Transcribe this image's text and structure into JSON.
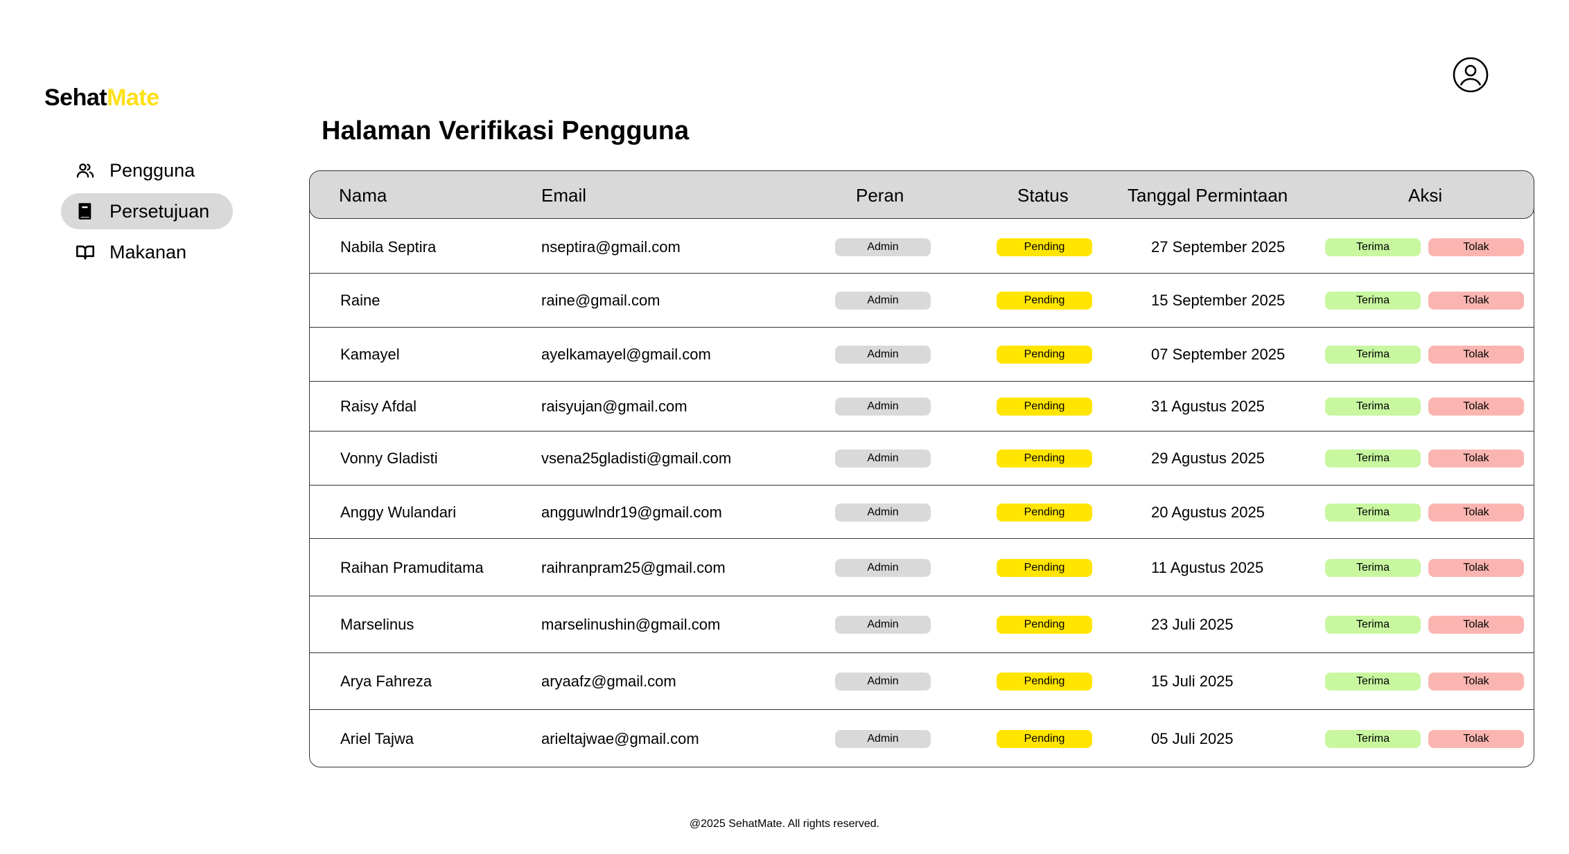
{
  "brand": {
    "part1": "Sehat",
    "part2": "Mate"
  },
  "sidebar": {
    "items": [
      {
        "label": "Pengguna",
        "icon": "users-icon",
        "active": false
      },
      {
        "label": "Persetujuan",
        "icon": "book-icon",
        "active": true
      },
      {
        "label": "Makanan",
        "icon": "open-book-icon",
        "active": false
      }
    ]
  },
  "header": {
    "profile_icon": "user-circle-icon"
  },
  "main": {
    "title": "Halaman Verifikasi Pengguna",
    "columns": {
      "name": "Nama",
      "email": "Email",
      "role": "Peran",
      "status": "Status",
      "date": "Tanggal Permintaan",
      "action": "Aksi"
    },
    "rows": [
      {
        "name": "Nabila Septira",
        "email": "nseptira@gmail.com",
        "role": "Admin",
        "status": "Pending",
        "date": "27 September 2025",
        "accept": "Terima",
        "reject": "Tolak"
      },
      {
        "name": "Raine",
        "email": "raine@gmail.com",
        "role": "Admin",
        "status": "Pending",
        "date": "15 September 2025",
        "accept": "Terima",
        "reject": "Tolak"
      },
      {
        "name": "Kamayel",
        "email": "ayelkamayel@gmail.com",
        "role": "Admin",
        "status": "Pending",
        "date": "07 September 2025",
        "accept": "Terima",
        "reject": "Tolak"
      },
      {
        "name": "Raisy Afdal",
        "email": "raisyujan@gmail.com",
        "role": "Admin",
        "status": "Pending",
        "date": "31 Agustus 2025",
        "accept": "Terima",
        "reject": "Tolak"
      },
      {
        "name": "Vonny Gladisti",
        "email": "vsena25gladisti@gmail.com",
        "role": "Admin",
        "status": "Pending",
        "date": "29 Agustus 2025",
        "accept": "Terima",
        "reject": "Tolak"
      },
      {
        "name": "Anggy Wulandari",
        "email": "angguwlndr19@gmail.com",
        "role": "Admin",
        "status": "Pending",
        "date": "20 Agustus 2025",
        "accept": "Terima",
        "reject": "Tolak"
      },
      {
        "name": "Raihan Pramuditama",
        "email": "raihranpram25@gmail.com",
        "role": "Admin",
        "status": "Pending",
        "date": "11 Agustus 2025",
        "accept": "Terima",
        "reject": "Tolak"
      },
      {
        "name": "Marselinus",
        "email": "marselinushin@gmail.com",
        "role": "Admin",
        "status": "Pending",
        "date": "23 Juli 2025",
        "accept": "Terima",
        "reject": "Tolak"
      },
      {
        "name": "Arya Fahreza",
        "email": "aryaafz@gmail.com",
        "role": "Admin",
        "status": "Pending",
        "date": "15 Juli 2025",
        "accept": "Terima",
        "reject": "Tolak"
      },
      {
        "name": "Ariel Tajwa",
        "email": "arieltajwae@gmail.com",
        "role": "Admin",
        "status": "Pending",
        "date": "05 Juli 2025",
        "accept": "Terima",
        "reject": "Tolak"
      }
    ]
  },
  "footer": {
    "text": "@2025 SehatMate. All rights reserved."
  },
  "colors": {
    "brand_accent": "#ffe019",
    "status_pending": "#ffe500",
    "accept": "#c8f7a0",
    "reject": "#fbb5b0",
    "neutral": "#d9d9d9"
  }
}
